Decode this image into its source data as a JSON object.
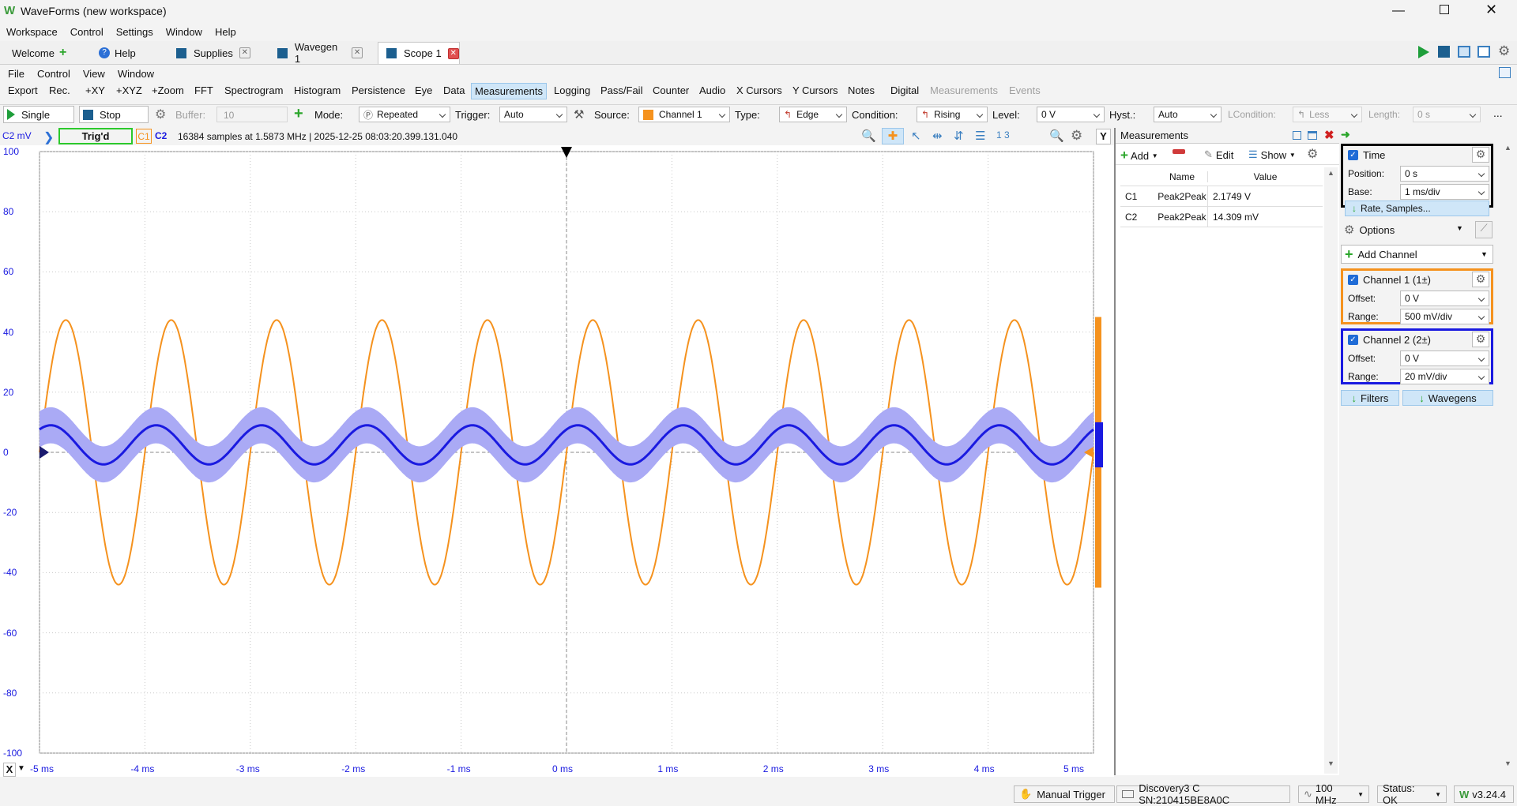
{
  "app": {
    "title": "WaveForms (new workspace)"
  },
  "menubar": [
    "Workspace",
    "Control",
    "Settings",
    "Window",
    "Help"
  ],
  "tabs": [
    {
      "label": "Welcome"
    },
    {
      "label": "Help"
    },
    {
      "label": "Supplies"
    },
    {
      "label": "Wavegen 1"
    },
    {
      "label": "Scope 1"
    }
  ],
  "submenu": [
    "File",
    "Control",
    "View",
    "Window"
  ],
  "scopemenu": [
    "Export",
    "Rec.",
    "+XY",
    "+XYZ",
    "+Zoom",
    "FFT",
    "Spectrogram",
    "Histogram",
    "Persistence",
    "Eye",
    "Data",
    "Measurements",
    "Logging",
    "Pass/Fail",
    "Counter",
    "Audio",
    "X Cursors",
    "Y Cursors",
    "Notes",
    "Digital",
    "Measurements",
    "Events"
  ],
  "toolbar": {
    "single": "Single",
    "stop": "Stop",
    "buffer_label": "Buffer:",
    "buffer_value": "10",
    "mode_label": "Mode:",
    "mode_value": "Repeated",
    "trigger_label": "Trigger:",
    "trigger_value": "Auto",
    "source_label": "Source:",
    "source_value": "Channel 1",
    "type_label": "Type:",
    "type_value": "Edge",
    "condition_label": "Condition:",
    "condition_value": "Rising",
    "level_label": "Level:",
    "level_value": "0 V",
    "hyst_label": "Hyst.:",
    "hyst_value": "Auto",
    "lcondition_label": "LCondition:",
    "lcondition_value": "Less",
    "length_label": "Length:",
    "length_value": "0 s",
    "more": "..."
  },
  "scopehdr": {
    "unit": "C2 mV",
    "status": "Trig'd",
    "c1": "C1",
    "c2": "C2",
    "info": "16384 samples at 1.5873 MHz  | 2025-12-25 08:03:20.399.131.040",
    "y_button": "Y"
  },
  "axes": {
    "y_ticks": [
      "100",
      "80",
      "60",
      "40",
      "20",
      "0",
      "-20",
      "-40",
      "-60",
      "-80",
      "-100"
    ],
    "x_ticks": [
      "-5 ms",
      "-4 ms",
      "-3 ms",
      "-2 ms",
      "-1 ms",
      "0 ms",
      "1 ms",
      "2 ms",
      "3 ms",
      "4 ms",
      "5 ms"
    ],
    "x_button": "X"
  },
  "measurements": {
    "title": "Measurements",
    "add": "Add",
    "edit": "Edit",
    "show": "Show",
    "col_name": "Name",
    "col_value": "Value",
    "rows": [
      {
        "ch": "C1",
        "name": "Peak2Peak",
        "value": "2.1749 V"
      },
      {
        "ch": "C2",
        "name": "Peak2Peak",
        "value": "14.309 mV"
      }
    ]
  },
  "time": {
    "title": "Time",
    "position_label": "Position:",
    "position_value": "0 s",
    "base_label": "Base:",
    "base_value": "1 ms/div",
    "rate": "Rate, Samples..."
  },
  "options": "Options",
  "add_channel": "Add Channel",
  "channel1": {
    "title": "Channel 1 (1±)",
    "offset_label": "Offset:",
    "offset_value": "0 V",
    "range_label": "Range:",
    "range_value": "500 mV/div"
  },
  "channel2": {
    "title": "Channel 2 (2±)",
    "offset_label": "Offset:",
    "offset_value": "0 V",
    "range_label": "Range:",
    "range_value": "20 mV/div"
  },
  "filters": "Filters",
  "wavegens": "Wavegens",
  "status": {
    "manual_trigger": "Manual Trigger",
    "device": "Discovery3 C SN:210415BE8A0C",
    "freq": "100 MHz",
    "status": "Status: OK",
    "version": "v3.24.4"
  },
  "colors": {
    "ch1": "#f5921e",
    "ch2": "#1a1ae0",
    "ch2_band": "#aaaaf5",
    "accent": "#1f6bd6"
  },
  "chart_data": {
    "type": "line",
    "x_unit": "ms",
    "y_unit": "mV",
    "xlim": [
      -5,
      5
    ],
    "ylim": [
      -100,
      100
    ],
    "grid": true,
    "series": [
      {
        "name": "C1",
        "waveform": "sine",
        "frequency_khz": 1,
        "amplitude_div": 2.2,
        "peak_to_peak": "2.1749 V",
        "phase": "rising through 0 at 0 ms"
      },
      {
        "name": "C2",
        "waveform": "sine",
        "frequency_khz": 1,
        "amplitude_mv": 6.5,
        "offset_mv": 3,
        "peak_to_peak": "14.309 mV",
        "phase": "peak near 0.25 ms shifted"
      }
    ]
  }
}
